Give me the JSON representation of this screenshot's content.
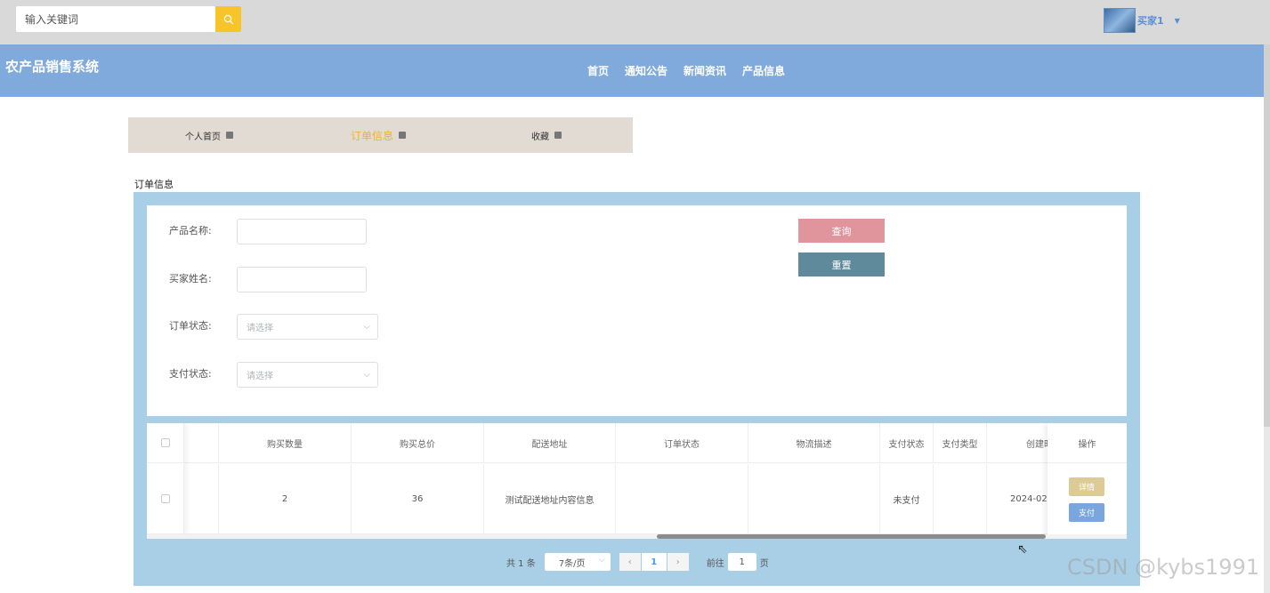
{
  "topbar": {
    "search_placeholder": "输入关键词",
    "username": "买家1"
  },
  "navbar": {
    "brand": "农产品销售系统",
    "links": [
      "首页",
      "通知公告",
      "新闻资讯",
      "产品信息"
    ]
  },
  "subnav": {
    "items": [
      {
        "label": "个人首页",
        "active": false
      },
      {
        "label": "订单信息",
        "active": true
      },
      {
        "label": "收藏",
        "active": false
      }
    ]
  },
  "section_title": "订单信息",
  "form": {
    "product_name_label": "产品名称:",
    "buyer_name_label": "买家姓名:",
    "order_status_label": "订单状态:",
    "order_status_placeholder": "请选择",
    "pay_status_label": "支付状态:",
    "pay_status_placeholder": "请选择",
    "query_button": "查询",
    "reset_button": "重置"
  },
  "table": {
    "columns": [
      "购买数量",
      "购买总价",
      "配送地址",
      "订单状态",
      "物流描述",
      "支付状态",
      "支付类型",
      "创建时",
      "操作"
    ],
    "rows": [
      {
        "quantity": "2",
        "total_price": "36",
        "address": "测试配送地址内容信息",
        "order_status": "",
        "logistics": "",
        "pay_status": "未支付",
        "pay_type": "",
        "created": "2024-02-",
        "actions": [
          "详情",
          "支付"
        ]
      }
    ]
  },
  "pagination": {
    "total": "共 1 条",
    "page_size": "7条/页",
    "current_page": "1",
    "goto_label": "前往",
    "goto_value": "1",
    "page_suffix": "页"
  },
  "watermark": "CSDN @kybs1991",
  "colors": {
    "topbar_bg": "#d9d9d9",
    "navbar_bg": "#80aadc",
    "accent_yellow": "#f7c52a",
    "query_btn": "#e0949c",
    "reset_btn": "#5f8a9c",
    "panel_bg": "#a9cfe6"
  }
}
